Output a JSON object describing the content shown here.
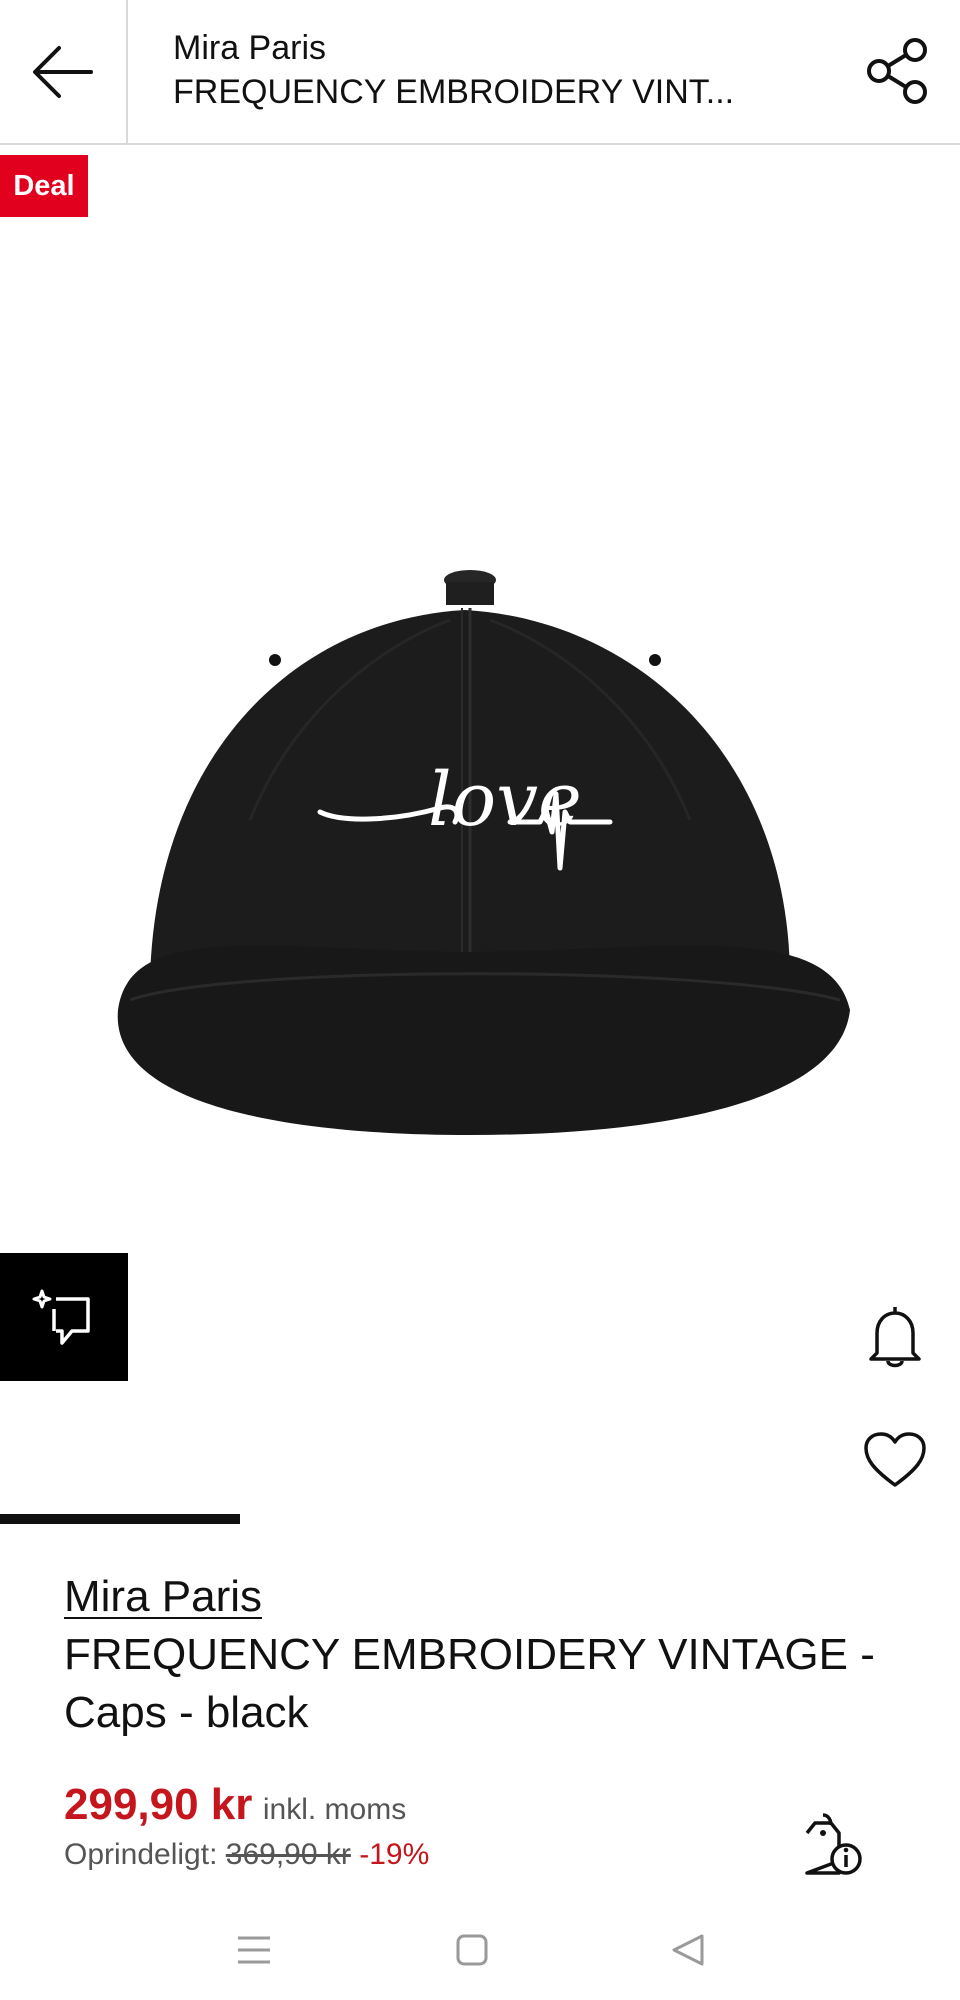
{
  "header": {
    "brand": "Mira Paris",
    "product_title": "FREQUENCY EMBROIDERY VINT..."
  },
  "badge": {
    "deal_label": "Deal"
  },
  "product": {
    "brand": "Mira Paris",
    "name": "FREQUENCY EMBROIDERY VINTAGE - Caps - black",
    "price": "299,90 kr",
    "vat_note": "inkl. moms",
    "original_label": "Oprindeligt:",
    "original_price": "369,90 kr",
    "discount": "-19%",
    "cap_embroidery": "love"
  },
  "gallery": {
    "progress_fraction": 0.25
  },
  "colors": {
    "deal_red": "#e1001e",
    "price_red": "#c4161c",
    "text": "#111111",
    "muted": "#555555"
  },
  "icons": {
    "back": "arrow-left-icon",
    "share": "share-icon",
    "try_on": "virtual-try-on-icon",
    "notify": "bell-icon",
    "wishlist": "heart-icon",
    "price_info": "price-tag-info-icon",
    "nav_recent": "menu-lines-icon",
    "nav_home": "square-icon",
    "nav_back": "triangle-back-icon"
  }
}
